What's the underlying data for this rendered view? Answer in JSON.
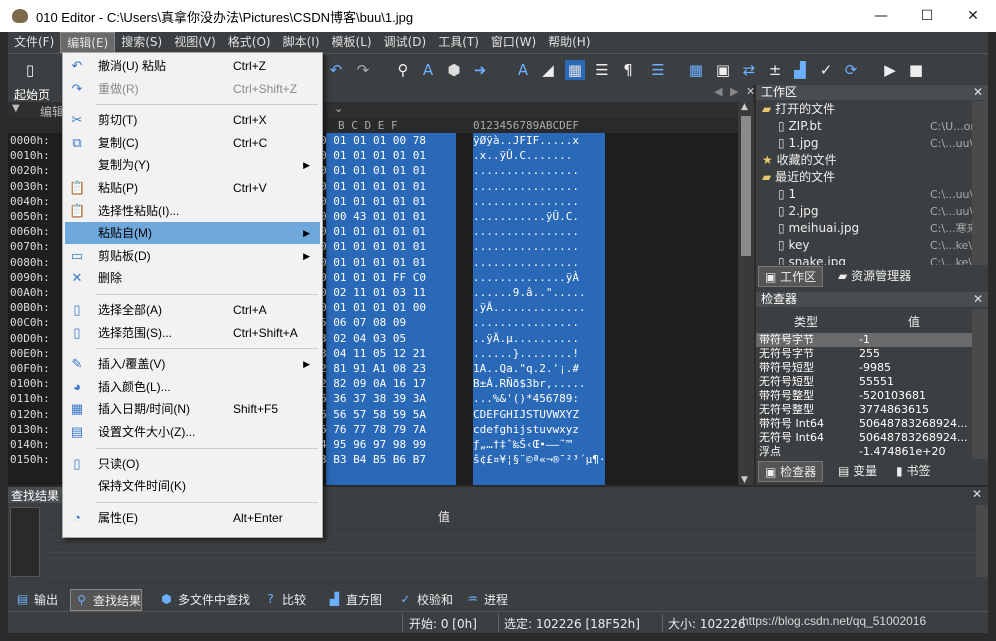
{
  "window": {
    "title": "010 Editor - C:\\Users\\真拿你没办法\\Pictures\\CSDN博客\\buu\\1.jpg",
    "min": "—",
    "max": "☐",
    "close": "✕"
  },
  "menubar": [
    "文件(F)",
    "编辑(E)",
    "搜索(S)",
    "视图(V)",
    "格式(O)",
    "脚本(I)",
    "模板(L)",
    "调试(D)",
    "工具(T)",
    "窗口(W)",
    "帮助(H)"
  ],
  "tab": {
    "label": "起始页"
  },
  "subheader": {
    "label": "编辑"
  },
  "hex_header": {
    "cols": "B  C  D  E  F",
    "text": "0123456789ABCDEF"
  },
  "rows": [
    {
      "addr": "0000h:",
      "hex": "0 01 01 01 00 78",
      "text": "ÿØÿà..JFIF.....x"
    },
    {
      "addr": "0010h:",
      "hex": "0 01 01 01 01 01",
      "text": ".x..ÿÛ.C......."
    },
    {
      "addr": "0020h:",
      "hex": "0 01 01 01 01 01",
      "text": "................"
    },
    {
      "addr": "0030h:",
      "hex": "0 01 01 01 01 01",
      "text": "................"
    },
    {
      "addr": "0040h:",
      "hex": "0 01 01 01 01 01",
      "text": "................"
    },
    {
      "addr": "0050h:",
      "hex": "0 00 43 01 01 01",
      "text": "...........ÿÛ.C."
    },
    {
      "addr": "0060h:",
      "hex": "0 01 01 01 01 01",
      "text": "................"
    },
    {
      "addr": "0070h:",
      "hex": "0 01 01 01 01 01",
      "text": "................"
    },
    {
      "addr": "0080h:",
      "hex": "0 01 01 01 01 01",
      "text": "................"
    },
    {
      "addr": "0090h:",
      "hex": "0 01 01 01 FF C0",
      "text": "..............ÿÀ"
    },
    {
      "addr": "00A0h:",
      "hex": "0 02 11 01 03 11",
      "text": "......9.â..\"....."
    },
    {
      "addr": "00B0h:",
      "hex": "0 01 01 01 01 00",
      "text": ".ÿÄ.............."
    },
    {
      "addr": "00C0h:",
      "hex": "5 06 07 08 09",
      "text": "................"
    },
    {
      "addr": "00D0h:",
      "hex": "3 02 04 03 05",
      "text": "..ÿÄ.µ.........."
    },
    {
      "addr": "00E0h:",
      "hex": "3 04 11 05 12 21",
      "text": "......}........!"
    },
    {
      "addr": "00F0h:",
      "hex": "2 81 91 A1 08 23",
      "text": "1A..Qa.\"q.2.'¡.#"
    },
    {
      "addr": "0100h:",
      "hex": "2 82 09 0A 16 17",
      "text": "B±Á.RÑð$3br,....."
    },
    {
      "addr": "0110h:",
      "hex": "6 36 37 38 39 3A",
      "text": "...%&'()*456789:"
    },
    {
      "addr": "0120h:",
      "hex": "6 56 57 58 59 5A",
      "text": "CDEFGHIJSTUVWXYZ"
    },
    {
      "addr": "0130h:",
      "hex": "6 76 77 78 79 7A",
      "text": "cdefghijstuvwxyz"
    },
    {
      "addr": "0140h:",
      "hex": "4 95 96 97 98 99",
      "text": "ƒ„…†‡ˆ‰Š‹Œ•–—˜™"
    },
    {
      "addr": "0150h:",
      "hex": "3 B3 B4 B5 B6 B7",
      "text": "š¢£¤¥¦§¨©ª«¬­®¯²³´µ¶·"
    }
  ],
  "workspace": {
    "title": "工作区",
    "open_files_label": "打开的文件",
    "open_files": [
      {
        "name": "ZIP.bt",
        "path": "C:\\U...ory\\"
      },
      {
        "name": "1.jpg",
        "path": "C:\\...uu\\"
      }
    ],
    "favorites_label": "收藏的文件",
    "recent_label": "最近的文件",
    "recent": [
      {
        "name": "1",
        "path": "C:\\...uu\\"
      },
      {
        "name": "2.jpg",
        "path": "C:\\...uu\\"
      },
      {
        "name": "meihuai.jpg",
        "path": "C:\\...寒来\\"
      },
      {
        "name": "key",
        "path": "C:\\...ke\\"
      },
      {
        "name": "snake.jpg",
        "path": "C:\\...ke\\"
      }
    ],
    "tabs": [
      "工作区",
      "资源管理器"
    ]
  },
  "inspector": {
    "title": "检查器",
    "col_type": "类型",
    "col_value": "值",
    "rows": [
      {
        "type": "带符号字节",
        "value": "-1",
        "selected": true
      },
      {
        "type": "无符号字节",
        "value": "255"
      },
      {
        "type": "带符号短型",
        "value": "-9985"
      },
      {
        "type": "无符号短型",
        "value": "55551"
      },
      {
        "type": "带符号整型",
        "value": "-520103681"
      },
      {
        "type": "无符号整型",
        "value": "3774863615"
      },
      {
        "type": "带符号 Int64",
        "value": "50648783268924..."
      },
      {
        "type": "无符号 Int64",
        "value": "50648783268924..."
      },
      {
        "type": "浮点",
        "value": "-1.474861e+20"
      }
    ],
    "tabs": [
      "检查器",
      "变量",
      "书签"
    ]
  },
  "findpanel": {
    "title": "查找结果",
    "col_value": "值"
  },
  "bottom_tabs": [
    "输出",
    "查找结果",
    "多文件中查找",
    "比较",
    "直方图",
    "校验和",
    "进程"
  ],
  "status": {
    "start": "开始: 0 [0h]",
    "selected": "选定: 102226 [18F52h]",
    "size": "大小: 102226"
  },
  "watermark": "https://blog.csdn.net/qq_51002016",
  "edit_menu": [
    {
      "label": "撤消(U) 粘贴",
      "shortcut": "Ctrl+Z",
      "icon": "↶",
      "iconname": "undo-icon"
    },
    {
      "label": "重做(R)",
      "shortcut": "Ctrl+Shift+Z",
      "icon": "↷",
      "iconname": "redo-icon",
      "disabled": true
    },
    {
      "sep": true
    },
    {
      "label": "剪切(T)",
      "shortcut": "Ctrl+X",
      "icon": "✂",
      "iconname": "cut-icon"
    },
    {
      "label": "复制(C)",
      "shortcut": "Ctrl+C",
      "icon": "⧉",
      "iconname": "copy-icon"
    },
    {
      "label": "复制为(Y)",
      "submenu": true,
      "iconname": "none"
    },
    {
      "label": "粘贴(P)",
      "shortcut": "Ctrl+V",
      "icon": "📋",
      "iconname": "paste-icon"
    },
    {
      "label": "选择性粘贴(I)...",
      "icon": "📋",
      "iconname": "paste-special-icon"
    },
    {
      "label": "粘贴自(M)",
      "submenu": true,
      "highlight": true,
      "iconname": "none"
    },
    {
      "label": "剪贴板(D)",
      "submenu": true,
      "icon": "▭",
      "iconname": "clipboard-icon"
    },
    {
      "label": "删除",
      "icon": "✕",
      "iconname": "delete-icon"
    },
    {
      "sep": true
    },
    {
      "label": "选择全部(A)",
      "shortcut": "Ctrl+A",
      "icon": "▯",
      "iconname": "select-all-icon"
    },
    {
      "label": "选择范围(S)...",
      "shortcut": "Ctrl+Shift+A",
      "icon": "▯",
      "iconname": "select-range-icon"
    },
    {
      "sep": true
    },
    {
      "label": "插入/覆盖(V)",
      "submenu": true,
      "icon": "✎",
      "iconname": "insert-overwrite-icon"
    },
    {
      "label": "插入颜色(L)...",
      "icon": "◕",
      "iconname": "color-icon"
    },
    {
      "label": "插入日期/时间(N)",
      "shortcut": "Shift+F5",
      "icon": "▦",
      "iconname": "datetime-icon"
    },
    {
      "label": "设置文件大小(Z)...",
      "icon": "▤",
      "iconname": "filesize-icon"
    },
    {
      "sep": true
    },
    {
      "label": "只读(O)",
      "icon": "▯",
      "iconname": "readonly-icon"
    },
    {
      "label": "保持文件时间(K)",
      "iconname": "none"
    },
    {
      "sep": true
    },
    {
      "label": "属性(E)",
      "shortcut": "Alt+Enter",
      "icon": "◔",
      "iconname": "properties-icon"
    }
  ]
}
